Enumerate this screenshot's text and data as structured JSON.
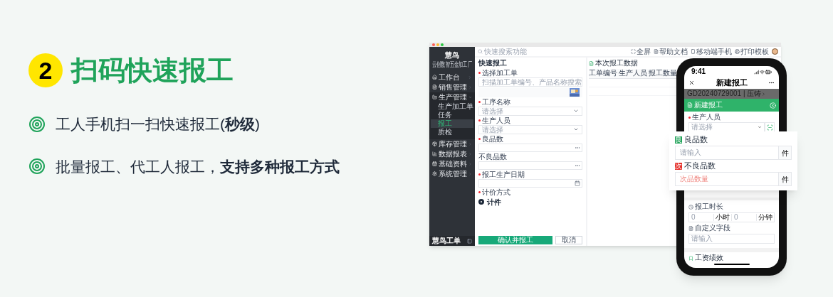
{
  "hero": {
    "step": "2",
    "title": "扫码快速报工",
    "bullets": [
      "工人手机扫一扫快速报工(**秒级**)",
      "批量报工、代工人报工，**支持多种报工方式**"
    ]
  },
  "desktop": {
    "brand": "慧鸟",
    "company": "云创数智五金加工厂",
    "search_placeholder": "快速搜索功能",
    "toolbar": [
      {
        "kind": "fullscreen",
        "label": "全屏"
      },
      {
        "kind": "doc",
        "label": "帮助文档"
      },
      {
        "kind": "phone",
        "label": "移动端手机"
      },
      {
        "kind": "print",
        "label": "打印模板"
      }
    ],
    "nav": [
      {
        "kind": "home",
        "label": "工作台",
        "expanded": false
      },
      {
        "kind": "sales",
        "label": "销售管理",
        "expanded": false
      },
      {
        "kind": "production",
        "label": "生产管理",
        "expanded": true,
        "children": [
          {
            "label": "生产加工单",
            "selected": false
          },
          {
            "label": "任务",
            "selected": false
          },
          {
            "label": "报工",
            "selected": true
          },
          {
            "label": "质检",
            "selected": false
          }
        ]
      },
      {
        "kind": "stock",
        "label": "库存管理",
        "expanded": false
      },
      {
        "kind": "report",
        "label": "数据报表",
        "expanded": false
      },
      {
        "kind": "basic",
        "label": "基础资料",
        "expanded": false
      },
      {
        "kind": "settings",
        "label": "系统管理",
        "expanded": false
      }
    ],
    "footer": "慧鸟工单",
    "form": {
      "title": "快速报工",
      "fields": [
        {
          "kind": "order",
          "label": "选择加工单",
          "required": true,
          "placeholder": "扫描加工单编号、产品名称搜索"
        },
        {
          "kind": "select",
          "label": "工序名称",
          "required": true,
          "placeholder": "请选择"
        },
        {
          "kind": "select",
          "label": "生产人员",
          "required": true,
          "placeholder": "请选择"
        },
        {
          "kind": "number",
          "label": "良品数",
          "required": true
        },
        {
          "kind": "number",
          "label": "不良品数",
          "required": false
        },
        {
          "kind": "date",
          "label": "报工生产日期",
          "required": true
        },
        {
          "kind": "radio",
          "label": "计价方式",
          "required": true,
          "option": "计件",
          "selected": true
        }
      ],
      "buttons": [
        {
          "kind": "primary",
          "label": "确认并报工"
        },
        {
          "kind": "secondary",
          "label": "取消"
        }
      ]
    },
    "table": {
      "title": "本次报工数据",
      "columns": [
        "工单编号",
        "生产人员",
        "报工数量"
      ]
    }
  },
  "phone": {
    "time": "9:41",
    "title": "新建报工",
    "order": "GD20240729001 | 压铸",
    "sheet_title": "新建报工",
    "worker": {
      "label": "生产人员",
      "required": true,
      "placeholder": "请选择"
    },
    "duration": {
      "label": "报工时长",
      "hours": "0",
      "hours_unit": "小时",
      "minutes": "0",
      "minutes_unit": "分钟"
    },
    "custom": {
      "label": "自定义字段",
      "placeholder": "请输入"
    },
    "section": "工资绩效"
  },
  "popup": [
    {
      "kind": "good",
      "badge": "良",
      "label": "良品数",
      "placeholder": "请输入",
      "unit": "件",
      "color": "#22a35a"
    },
    {
      "kind": "defect",
      "badge": "次",
      "label": "不良品数",
      "placeholder": "次品数量",
      "unit": "件",
      "color": "#e5312b"
    }
  ]
}
